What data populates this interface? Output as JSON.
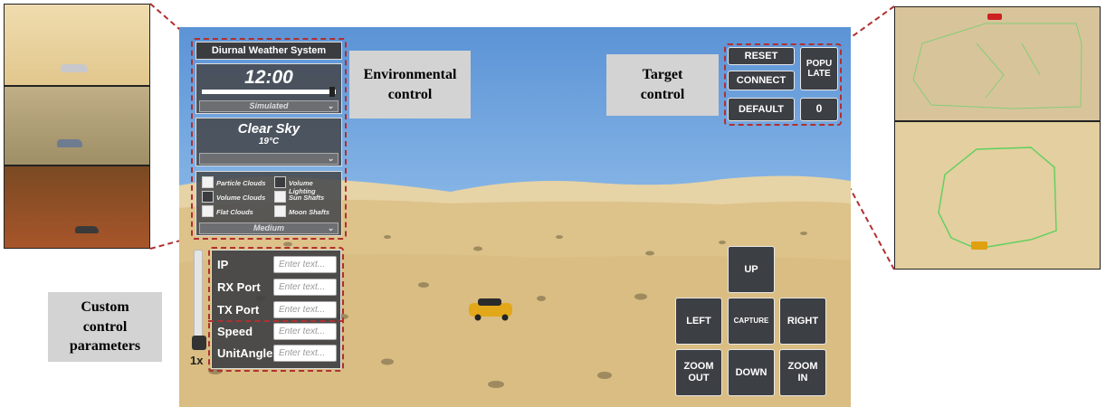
{
  "annotations": {
    "environmental": "Environmental\ncontrol",
    "target": "Target\ncontrol",
    "custom": "Custom\ncontrol\nparameters"
  },
  "weather_panel": {
    "title": "Diurnal Weather System",
    "time": "12:00",
    "time_progress": 0.97,
    "time_mode": "Simulated",
    "condition": "Clear Sky",
    "temperature": "19°C",
    "options": [
      {
        "label": "Particle Clouds",
        "checked": false
      },
      {
        "label": "Volume Lighting",
        "checked": true
      },
      {
        "label": "Volume Clouds",
        "checked": true
      },
      {
        "label": "Sun Shafts",
        "checked": false
      },
      {
        "label": "Flat Clouds",
        "checked": false
      },
      {
        "label": "Moon Shafts",
        "checked": false
      }
    ],
    "quality": "Medium"
  },
  "target_panel": {
    "reset": "RESET",
    "connect": "CONNECT",
    "populate": "POPU\nLATE",
    "default": "DEFAULT",
    "count": "0"
  },
  "params_panel": {
    "fields": [
      {
        "label": "IP",
        "placeholder": "Enter text..."
      },
      {
        "label": "RX Port",
        "placeholder": "Enter text..."
      },
      {
        "label": "TX Port",
        "placeholder": "Enter text..."
      },
      {
        "label": "Speed",
        "placeholder": "Enter text..."
      },
      {
        "label": "UnitAngle",
        "placeholder": "Enter text..."
      }
    ],
    "speed_multiplier": "1x",
    "speed_level": 0.05
  },
  "camera_panel": {
    "up": "UP",
    "left": "LEFT",
    "capture": "CAPTURE",
    "right": "RIGHT",
    "zoom_out": "ZOOM\nOUT",
    "down": "DOWN",
    "zoom_in": "ZOOM\nIN"
  },
  "colors": {
    "dash_red": "#b03030",
    "panel_dark": "#3c3f44",
    "sand": "#d9c08a"
  }
}
